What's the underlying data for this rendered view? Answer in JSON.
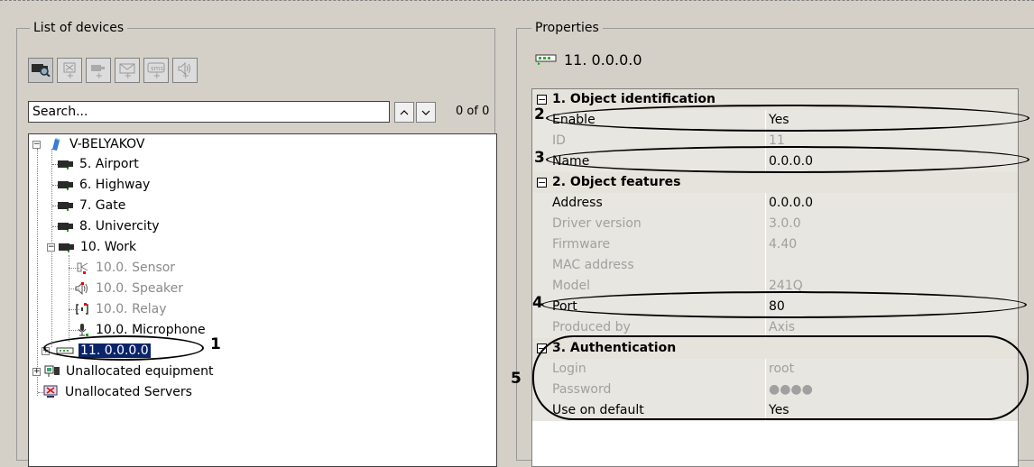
{
  "list_panel": {
    "title": "List of devices",
    "toolbar": [
      {
        "name": "find-camera-icon",
        "state": "active"
      },
      {
        "name": "add-sensor-icon",
        "state": "disabled"
      },
      {
        "name": "add-camera-icon",
        "state": "disabled"
      },
      {
        "name": "add-mail-icon",
        "state": "disabled"
      },
      {
        "name": "add-sms-icon",
        "state": "disabled"
      },
      {
        "name": "add-speaker-icon",
        "state": "disabled"
      }
    ],
    "search_placeholder": "Search...",
    "search_value": "Search...",
    "count": "0 of 0",
    "tree": {
      "root": "V-BELYAKOV",
      "cameras": [
        "5. Airport",
        "6. Highway",
        "7. Gate",
        "8. Univercity"
      ],
      "work": "10. Work",
      "work_children": [
        "10.0. Sensor",
        "10.0. Speaker",
        "10.0. Relay",
        "10.0. Microphone"
      ],
      "selected": "11. 0.0.0.0",
      "unallocated_equipment": "Unallocated equipment",
      "unallocated_servers": "Unallocated Servers"
    }
  },
  "properties_panel": {
    "title": "Properties",
    "object_name": "11. 0.0.0.0",
    "sections": [
      {
        "title": "1. Object identification",
        "rows": [
          {
            "name": "Enable",
            "value": "Yes",
            "dim": false
          },
          {
            "name": "ID",
            "value": "11",
            "dim": true
          },
          {
            "name": "Name",
            "value": "0.0.0.0",
            "dim": false
          }
        ]
      },
      {
        "title": "2. Object features",
        "rows": [
          {
            "name": "Address",
            "value": "0.0.0.0",
            "dim": false
          },
          {
            "name": "Driver version",
            "value": "3.0.0",
            "dim": true
          },
          {
            "name": "Firmware",
            "value": "4.40",
            "dim": true
          },
          {
            "name": "MAC address",
            "value": "",
            "dim": true
          },
          {
            "name": "Model",
            "value": "241Q",
            "dim": true
          },
          {
            "name": "Port",
            "value": "80",
            "dim": false
          },
          {
            "name": "Produced by",
            "value": "Axis",
            "dim": true
          }
        ]
      },
      {
        "title": "3. Authentication",
        "rows": [
          {
            "name": "Login",
            "value": "root",
            "dim": true
          },
          {
            "name": "Password",
            "value": "●●●●",
            "dim": true
          },
          {
            "name": "Use on default",
            "value": "Yes",
            "dim": false
          }
        ]
      }
    ]
  },
  "annotations": [
    "1",
    "2",
    "3",
    "4",
    "5"
  ]
}
